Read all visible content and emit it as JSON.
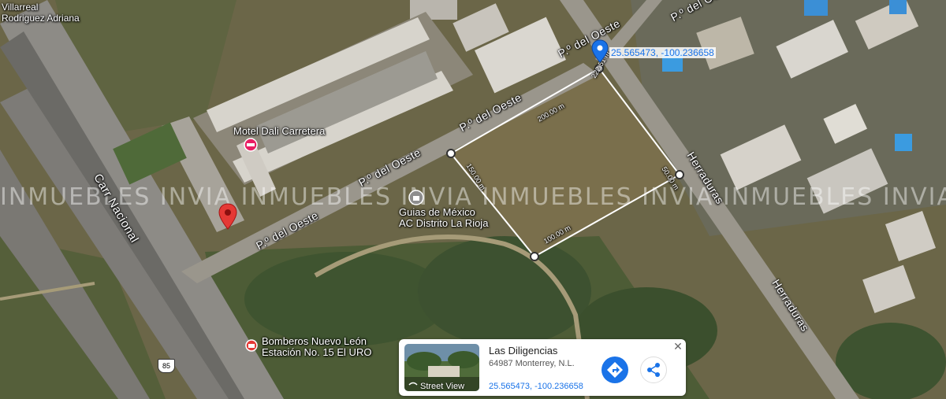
{
  "map": {
    "roads": {
      "paseo_top": "P.º del Oeste",
      "paseo_mid": "P.º del Oeste",
      "paseo_low": "P.º del Oeste",
      "paseo_bottom": "P.º del Oeste",
      "carr_nacional": "Carr Nacional",
      "herraduras_top": "Herraduras",
      "herraduras_bottom": "Herraduras",
      "highway_shield": "85"
    },
    "pois": {
      "villarreal": "Villarreal\nRodriguez Adriana",
      "motel": "Motel Dali Carretera",
      "guias": "Guias de México\nAC Distrito La Rioja",
      "bomberos": "Bomberos Nuevo León\nEstación No. 15 El URO"
    },
    "pin_coordinates": "25.565473, -100.236658",
    "measurements": {
      "top": "222.51 m",
      "upper_left": "200.00 m",
      "left": "150.00 m",
      "right": "50.00 m",
      "bottom": "100.00 m"
    },
    "watermark": "INMUEBLES INVIA INMUEBLES INVIA INMUEBLES INVIA INMUEBLES INVIA INMUEBLES"
  },
  "info_card": {
    "title": "Las Diligencias",
    "address": "64987 Monterrey, N.L.",
    "coordinates": "25.565473, -100.236658",
    "street_view_label": "Street View",
    "close_glyph": "✕"
  },
  "colors": {
    "pin_blue": "#1a73e8",
    "pin_red": "#e53935",
    "poi_pink": "#e91e63"
  }
}
